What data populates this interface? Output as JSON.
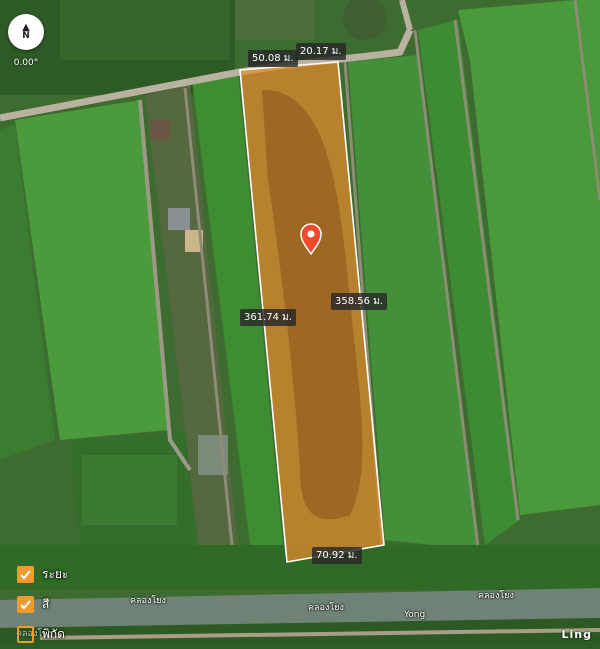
{
  "compass": {
    "north_label": "N",
    "bearing": "0.00°"
  },
  "plot": {
    "fill_color": "#e8892c",
    "outline_color": "#ffffff",
    "marker_color": "#f0492b",
    "marker_icon": "map-pin-icon"
  },
  "dimensions": {
    "top_left": "50.08 ม.",
    "top_right": "20.17 ม.",
    "left": "361.74 ม.",
    "right": "358.56 ม.",
    "bottom": "70.92 ม."
  },
  "places": {
    "canal_left": "คลองโยง",
    "canal_center": "คลองโยง",
    "canal_right": "คลองโยง",
    "canal_en": "Yong",
    "canal_bottom_left": "คลองโยง"
  },
  "legend": {
    "items": [
      {
        "label": "ระยะ",
        "checked": true
      },
      {
        "label": "สี",
        "checked": true
      },
      {
        "label": "พิกัด",
        "checked": false
      }
    ],
    "accent": "#f29a2e"
  },
  "attribution": "Ling"
}
